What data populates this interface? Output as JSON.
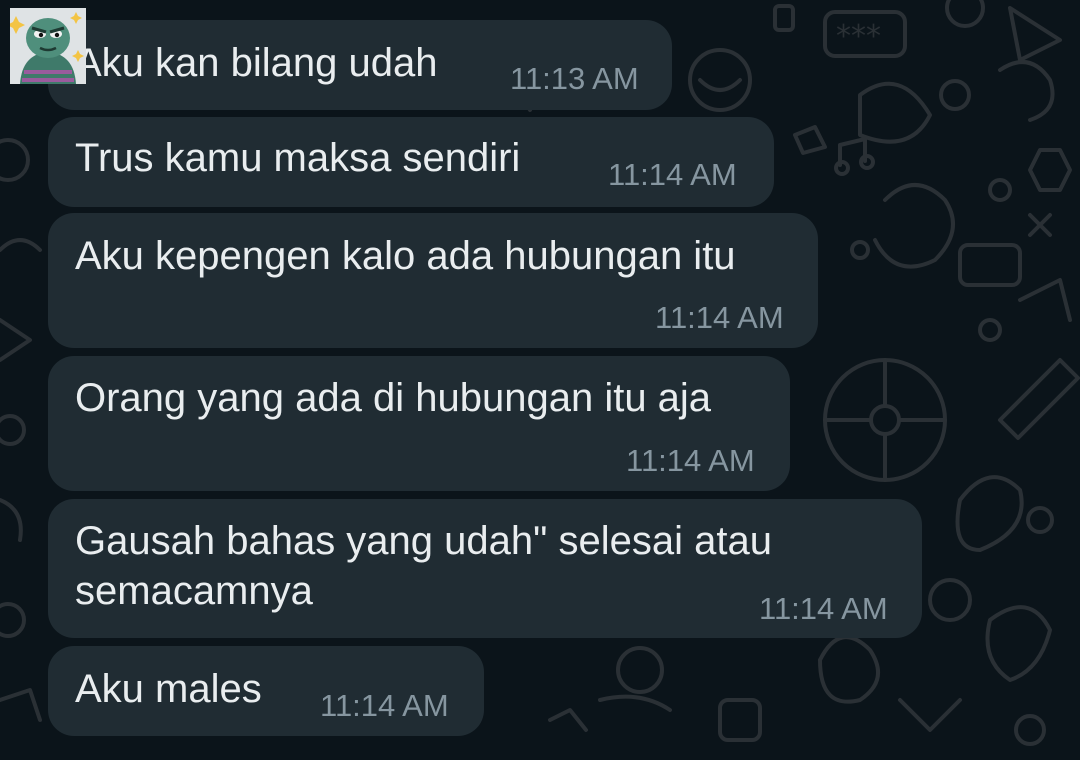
{
  "chat": {
    "messages": [
      {
        "text": "Aku kan bilang udah",
        "time": "11:13 AM"
      },
      {
        "text": "Trus kamu maksa sendiri",
        "time": "11:14 AM"
      },
      {
        "text": "Aku kepengen kalo ada hubungan itu",
        "time": "11:14 AM"
      },
      {
        "text": "Orang yang ada di hubungan itu aja",
        "time": "11:14 AM"
      },
      {
        "text": "Gausah bahas yang udah\" selesai atau\nsemacamnya",
        "time": "11:14 AM"
      },
      {
        "text": "Aku males",
        "time": "11:14 AM"
      }
    ]
  },
  "sender": {
    "avatar_icon": "sticker-avatar-icon"
  },
  "colors": {
    "background": "#0b141a",
    "bubble": "#202c33",
    "text": "#e9edef",
    "timestamp": "#8696a0"
  }
}
